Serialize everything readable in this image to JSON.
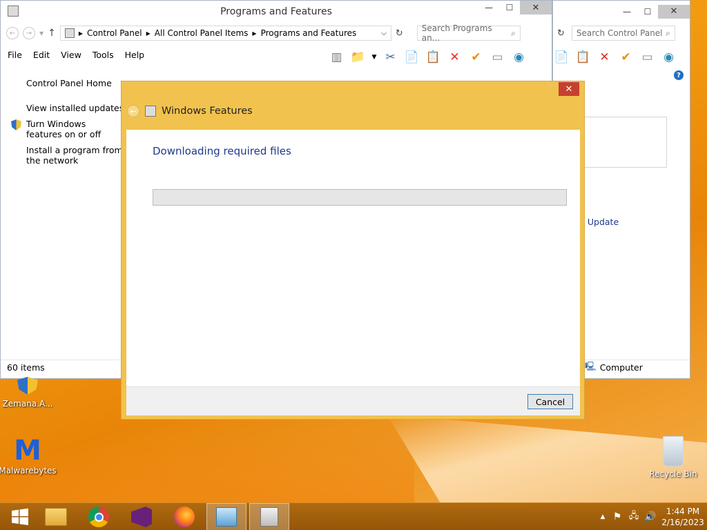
{
  "back_window": {
    "search_placeholder": "Search Control Panel",
    "status_text": "Computer",
    "link_text": "t Update"
  },
  "main_window": {
    "title": "Programs and Features",
    "breadcrumb": [
      "Control Panel",
      "All Control Panel Items",
      "Programs and Features"
    ],
    "search_placeholder": "Search Programs an...",
    "menu": [
      "File",
      "Edit",
      "View",
      "Tools",
      "Help"
    ],
    "sidebar": {
      "home": "Control Panel Home",
      "items": [
        {
          "label": "View installed updates",
          "icon": ""
        },
        {
          "label": "Turn Windows features on or off",
          "icon": "shield-icon"
        },
        {
          "label": "Install a program from the network",
          "icon": ""
        }
      ]
    },
    "status_text": "60 items"
  },
  "dialog": {
    "title": "Windows Features",
    "heading": "Downloading required files",
    "progress": 0,
    "cancel_label": "Cancel"
  },
  "desktop_icons": [
    {
      "label": "Zemana.A...",
      "icon": "zemana-shield-icon"
    },
    {
      "label": "Malwarebytes",
      "icon": "malwarebytes-icon"
    },
    {
      "label": "Recycle Bin",
      "icon": "recycle-bin-icon"
    }
  ],
  "taskbar": {
    "apps": [
      "start-icon",
      "file-explorer-icon",
      "chrome-icon",
      "visual-studio-icon",
      "firefox-icon",
      "control-panel-icon",
      "programs-features-icon"
    ],
    "time": "1:44 PM",
    "date": "2/16/2023"
  },
  "colors": {
    "dialog_frame": "#f2c24f",
    "desktop": "#f39a10",
    "taskbar": "#a0600c",
    "link": "#1e3a8a"
  }
}
